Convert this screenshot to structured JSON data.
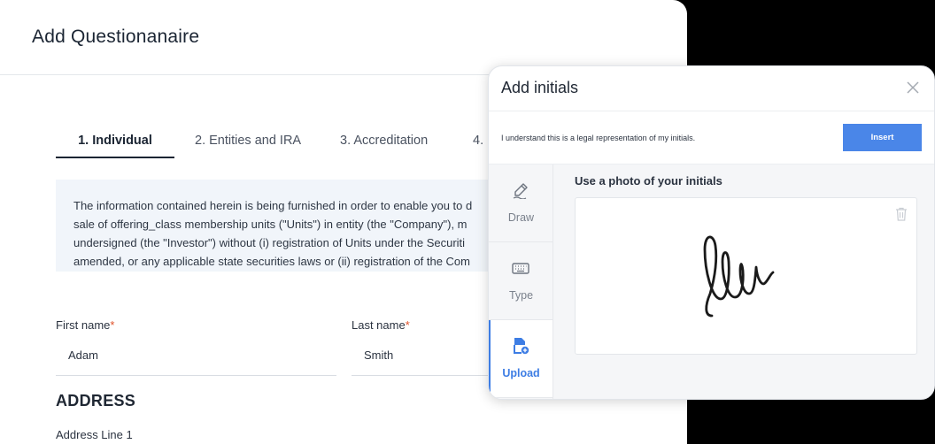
{
  "main": {
    "title": "Add Questionanaire",
    "tabs": [
      {
        "label": "1. Individual",
        "active": true
      },
      {
        "label": "2. Entities and IRA",
        "active": false
      },
      {
        "label": "3. Accreditation",
        "active": false
      },
      {
        "label": "4.",
        "active": false
      }
    ],
    "info_lines": [
      "The information contained herein is being furnished in order to enable you to d",
      "sale of offering_class membership units (\"Units\") in entity (the \"Company\"), m",
      "undersigned (the \"Investor\") without (i) registration of Units under the Securiti",
      "amended, or any applicable state securities laws or (ii) registration of the Com"
    ],
    "first_name": {
      "label": "First name",
      "required_mark": "*",
      "value": "Adam"
    },
    "last_name": {
      "label": "Last name",
      "required_mark": "*",
      "value": "Smith"
    },
    "address_heading": "ADDRESS",
    "address_line1_label": "Address Line 1"
  },
  "modal": {
    "title": "Add initials",
    "legal_text": "I understand this is a legal representation of my initials.",
    "insert_label": "Insert",
    "side_tabs": [
      {
        "label": "Draw",
        "icon": "pen-icon",
        "active": false
      },
      {
        "label": "Type",
        "icon": "keyboard-icon",
        "active": false
      },
      {
        "label": "Upload",
        "icon": "file-upload-icon",
        "active": true
      }
    ],
    "content_title": "Use a photo of your initials",
    "accent_color": "#3d7de4"
  }
}
